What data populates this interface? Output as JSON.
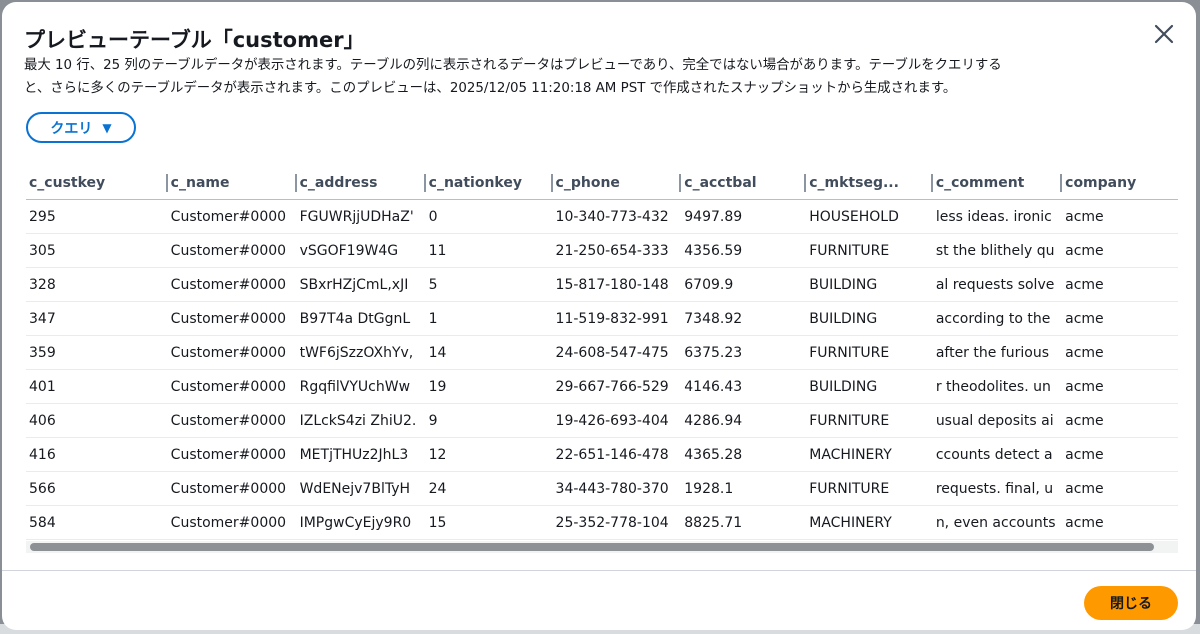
{
  "modal": {
    "title": "プレビューテーブル「customer」",
    "description_line1": "最大 10 行、25 列のテーブルデータが表示されます。テーブルの列に表示されるデータはプレビューであり、完全ではない場合があります。テーブルをクエリする",
    "description_line2": "と、さらに多くのテーブルデータが表示されます。このプレビューは、2025/12/05 11:20:18 AM PST で作成されたスナップショットから生成されます。",
    "close_icon": "close-icon"
  },
  "query_button": {
    "label": "クエリ",
    "icon": "caret-down-icon"
  },
  "table": {
    "columns": [
      "c_custkey",
      "c_name",
      "c_address",
      "c_nationkey",
      "c_phone",
      "c_acctbal",
      "c_mktseg...",
      "c_comment",
      "company"
    ],
    "rows": [
      [
        "295",
        "Customer#0000",
        "FGUWRjjUDHaZ'",
        "0",
        "10-340-773-432",
        "9497.89",
        "HOUSEHOLD",
        "less ideas. ironic",
        "acme"
      ],
      [
        "305",
        "Customer#0000",
        "vSGOF19W4G",
        "11",
        "21-250-654-333",
        "4356.59",
        "FURNITURE",
        "st the blithely qu",
        "acme"
      ],
      [
        "328",
        "Customer#0000",
        "SBxrHZjCmL,xJI",
        "5",
        "15-817-180-148",
        "6709.9",
        "BUILDING",
        "al requests solve",
        "acme"
      ],
      [
        "347",
        "Customer#0000",
        "B97T4a DtGgnL",
        "1",
        "11-519-832-991",
        "7348.92",
        "BUILDING",
        "according to the",
        "acme"
      ],
      [
        "359",
        "Customer#0000",
        "tWF6jSzzOXhYv,",
        "14",
        "24-608-547-475",
        "6375.23",
        "FURNITURE",
        "after the furious",
        "acme"
      ],
      [
        "401",
        "Customer#0000",
        "RgqfilVYUchWw",
        "19",
        "29-667-766-529",
        "4146.43",
        "BUILDING",
        "r theodolites. un",
        "acme"
      ],
      [
        "406",
        "Customer#0000",
        "IZLckS4zi ZhiU2.",
        "9",
        "19-426-693-404",
        "4286.94",
        "FURNITURE",
        "usual deposits ai",
        "acme"
      ],
      [
        "416",
        "Customer#0000",
        "METjTHUz2JhL3",
        "12",
        "22-651-146-478",
        "4365.28",
        "MACHINERY",
        "ccounts detect a",
        "acme"
      ],
      [
        "566",
        "Customer#0000",
        "WdENejv7BlTyH",
        "24",
        "34-443-780-370",
        "1928.1",
        "FURNITURE",
        "requests. final, u",
        "acme"
      ],
      [
        "584",
        "Customer#0000",
        "IMPgwCyEjy9R0",
        "15",
        "25-352-778-104",
        "8825.71",
        "MACHINERY",
        "n, even accounts",
        "acme"
      ]
    ]
  },
  "footer": {
    "close_label": "閉じる"
  },
  "colors": {
    "primary": "#ff9900",
    "link": "#0972d3",
    "text": "#16191f"
  }
}
